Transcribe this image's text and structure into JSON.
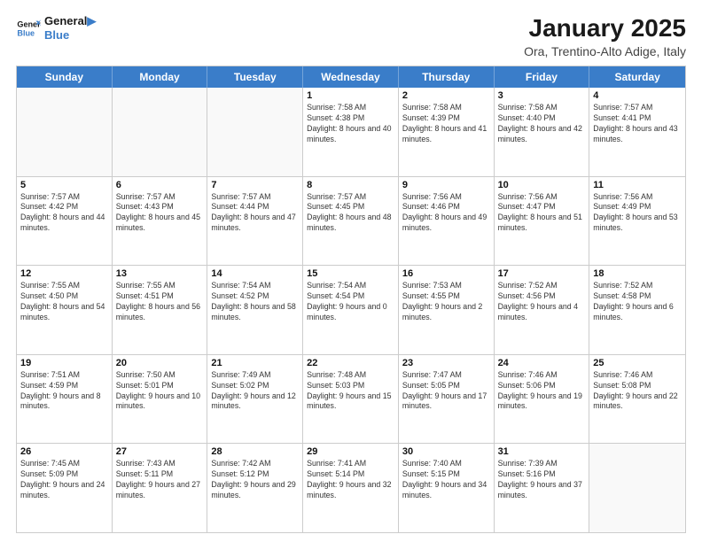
{
  "header": {
    "logo_line1": "General",
    "logo_line2": "Blue",
    "month": "January 2025",
    "location": "Ora, Trentino-Alto Adige, Italy"
  },
  "weekdays": [
    "Sunday",
    "Monday",
    "Tuesday",
    "Wednesday",
    "Thursday",
    "Friday",
    "Saturday"
  ],
  "weeks": [
    [
      {
        "day": "",
        "sunrise": "",
        "sunset": "",
        "daylight": ""
      },
      {
        "day": "",
        "sunrise": "",
        "sunset": "",
        "daylight": ""
      },
      {
        "day": "",
        "sunrise": "",
        "sunset": "",
        "daylight": ""
      },
      {
        "day": "1",
        "sunrise": "Sunrise: 7:58 AM",
        "sunset": "Sunset: 4:38 PM",
        "daylight": "Daylight: 8 hours and 40 minutes."
      },
      {
        "day": "2",
        "sunrise": "Sunrise: 7:58 AM",
        "sunset": "Sunset: 4:39 PM",
        "daylight": "Daylight: 8 hours and 41 minutes."
      },
      {
        "day": "3",
        "sunrise": "Sunrise: 7:58 AM",
        "sunset": "Sunset: 4:40 PM",
        "daylight": "Daylight: 8 hours and 42 minutes."
      },
      {
        "day": "4",
        "sunrise": "Sunrise: 7:57 AM",
        "sunset": "Sunset: 4:41 PM",
        "daylight": "Daylight: 8 hours and 43 minutes."
      }
    ],
    [
      {
        "day": "5",
        "sunrise": "Sunrise: 7:57 AM",
        "sunset": "Sunset: 4:42 PM",
        "daylight": "Daylight: 8 hours and 44 minutes."
      },
      {
        "day": "6",
        "sunrise": "Sunrise: 7:57 AM",
        "sunset": "Sunset: 4:43 PM",
        "daylight": "Daylight: 8 hours and 45 minutes."
      },
      {
        "day": "7",
        "sunrise": "Sunrise: 7:57 AM",
        "sunset": "Sunset: 4:44 PM",
        "daylight": "Daylight: 8 hours and 47 minutes."
      },
      {
        "day": "8",
        "sunrise": "Sunrise: 7:57 AM",
        "sunset": "Sunset: 4:45 PM",
        "daylight": "Daylight: 8 hours and 48 minutes."
      },
      {
        "day": "9",
        "sunrise": "Sunrise: 7:56 AM",
        "sunset": "Sunset: 4:46 PM",
        "daylight": "Daylight: 8 hours and 49 minutes."
      },
      {
        "day": "10",
        "sunrise": "Sunrise: 7:56 AM",
        "sunset": "Sunset: 4:47 PM",
        "daylight": "Daylight: 8 hours and 51 minutes."
      },
      {
        "day": "11",
        "sunrise": "Sunrise: 7:56 AM",
        "sunset": "Sunset: 4:49 PM",
        "daylight": "Daylight: 8 hours and 53 minutes."
      }
    ],
    [
      {
        "day": "12",
        "sunrise": "Sunrise: 7:55 AM",
        "sunset": "Sunset: 4:50 PM",
        "daylight": "Daylight: 8 hours and 54 minutes."
      },
      {
        "day": "13",
        "sunrise": "Sunrise: 7:55 AM",
        "sunset": "Sunset: 4:51 PM",
        "daylight": "Daylight: 8 hours and 56 minutes."
      },
      {
        "day": "14",
        "sunrise": "Sunrise: 7:54 AM",
        "sunset": "Sunset: 4:52 PM",
        "daylight": "Daylight: 8 hours and 58 minutes."
      },
      {
        "day": "15",
        "sunrise": "Sunrise: 7:54 AM",
        "sunset": "Sunset: 4:54 PM",
        "daylight": "Daylight: 9 hours and 0 minutes."
      },
      {
        "day": "16",
        "sunrise": "Sunrise: 7:53 AM",
        "sunset": "Sunset: 4:55 PM",
        "daylight": "Daylight: 9 hours and 2 minutes."
      },
      {
        "day": "17",
        "sunrise": "Sunrise: 7:52 AM",
        "sunset": "Sunset: 4:56 PM",
        "daylight": "Daylight: 9 hours and 4 minutes."
      },
      {
        "day": "18",
        "sunrise": "Sunrise: 7:52 AM",
        "sunset": "Sunset: 4:58 PM",
        "daylight": "Daylight: 9 hours and 6 minutes."
      }
    ],
    [
      {
        "day": "19",
        "sunrise": "Sunrise: 7:51 AM",
        "sunset": "Sunset: 4:59 PM",
        "daylight": "Daylight: 9 hours and 8 minutes."
      },
      {
        "day": "20",
        "sunrise": "Sunrise: 7:50 AM",
        "sunset": "Sunset: 5:01 PM",
        "daylight": "Daylight: 9 hours and 10 minutes."
      },
      {
        "day": "21",
        "sunrise": "Sunrise: 7:49 AM",
        "sunset": "Sunset: 5:02 PM",
        "daylight": "Daylight: 9 hours and 12 minutes."
      },
      {
        "day": "22",
        "sunrise": "Sunrise: 7:48 AM",
        "sunset": "Sunset: 5:03 PM",
        "daylight": "Daylight: 9 hours and 15 minutes."
      },
      {
        "day": "23",
        "sunrise": "Sunrise: 7:47 AM",
        "sunset": "Sunset: 5:05 PM",
        "daylight": "Daylight: 9 hours and 17 minutes."
      },
      {
        "day": "24",
        "sunrise": "Sunrise: 7:46 AM",
        "sunset": "Sunset: 5:06 PM",
        "daylight": "Daylight: 9 hours and 19 minutes."
      },
      {
        "day": "25",
        "sunrise": "Sunrise: 7:46 AM",
        "sunset": "Sunset: 5:08 PM",
        "daylight": "Daylight: 9 hours and 22 minutes."
      }
    ],
    [
      {
        "day": "26",
        "sunrise": "Sunrise: 7:45 AM",
        "sunset": "Sunset: 5:09 PM",
        "daylight": "Daylight: 9 hours and 24 minutes."
      },
      {
        "day": "27",
        "sunrise": "Sunrise: 7:43 AM",
        "sunset": "Sunset: 5:11 PM",
        "daylight": "Daylight: 9 hours and 27 minutes."
      },
      {
        "day": "28",
        "sunrise": "Sunrise: 7:42 AM",
        "sunset": "Sunset: 5:12 PM",
        "daylight": "Daylight: 9 hours and 29 minutes."
      },
      {
        "day": "29",
        "sunrise": "Sunrise: 7:41 AM",
        "sunset": "Sunset: 5:14 PM",
        "daylight": "Daylight: 9 hours and 32 minutes."
      },
      {
        "day": "30",
        "sunrise": "Sunrise: 7:40 AM",
        "sunset": "Sunset: 5:15 PM",
        "daylight": "Daylight: 9 hours and 34 minutes."
      },
      {
        "day": "31",
        "sunrise": "Sunrise: 7:39 AM",
        "sunset": "Sunset: 5:16 PM",
        "daylight": "Daylight: 9 hours and 37 minutes."
      },
      {
        "day": "",
        "sunrise": "",
        "sunset": "",
        "daylight": ""
      }
    ]
  ]
}
